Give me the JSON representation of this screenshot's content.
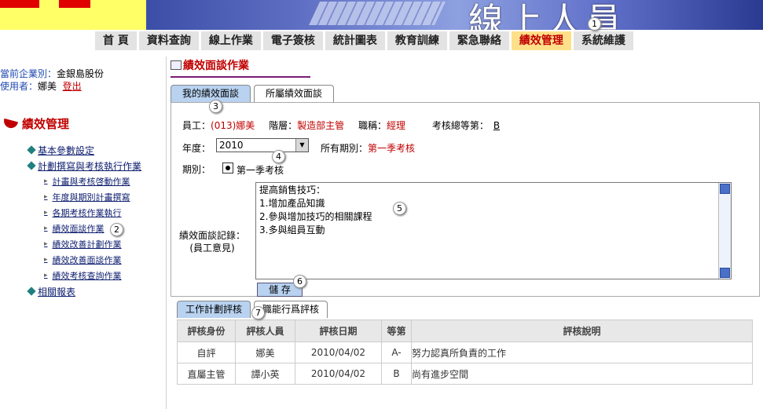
{
  "banner": {
    "title": "線上人員"
  },
  "nav": {
    "items": [
      "首 頁",
      "資料查詢",
      "線上作業",
      "電子簽核",
      "統計圖表",
      "教育訓練",
      "緊急聯絡",
      "績效管理",
      "系統維護"
    ],
    "active_index": 7
  },
  "markers": [
    "1",
    "2",
    "3",
    "4",
    "5",
    "6",
    "7"
  ],
  "sidebar": {
    "company_label": "當前企業別：",
    "company_value": "金銀島股份",
    "user_label": "使用者：",
    "user_value": "娜美",
    "logout": "登出",
    "section_title": "績效管理",
    "menu": {
      "basic": "基本參數設定",
      "plan_exec": "計劃撰寫與考核執行作業",
      "sub": [
        "計畫與考核啓動作業",
        "年度與期別計畫撰寫",
        "各期考核作業執行",
        "績效面談作業",
        "績效改善計劃作業",
        "績效改善面談作業",
        "績效考核查詢作業"
      ],
      "reports": "相關報表"
    }
  },
  "main": {
    "title": "績效面談作業",
    "tabs": [
      "我的績效面談",
      "所屬績效面談"
    ],
    "employee_label": "員工：",
    "employee_value": "(013)娜美",
    "level_label": "階層：",
    "level_value": "製造部主管",
    "position_label": "職稱：",
    "position_value": "經理",
    "grade_label": "考核總等第：",
    "grade_value": "B",
    "year_label": "年度：",
    "year_value": "2010",
    "all_periods_label": "所有期別：",
    "all_periods_value": "第一季考核",
    "period_label": "期別：",
    "period_option": "第一季考核",
    "record_label_1": "績效面談記錄：",
    "record_label_2": "(員工意見)",
    "record_lines": [
      "提高銷售技巧：",
      "1.增加產品知識",
      "2.參與增加技巧的相關課程",
      "3.多與組員互動"
    ],
    "save": "儲 存",
    "sub_tabs": [
      "工作計劃評核",
      "職能行爲評核"
    ],
    "table": {
      "headers": [
        "評核身份",
        "評核人員",
        "評核日期",
        "等第",
        "評核說明"
      ],
      "rows": [
        [
          "自評",
          "娜美",
          "2010/04/02",
          "A-",
          "努力認真所負責的工作"
        ],
        [
          "直屬主管",
          "譚小英",
          "2010/04/02",
          "B",
          "尚有進步空間"
        ]
      ]
    }
  }
}
